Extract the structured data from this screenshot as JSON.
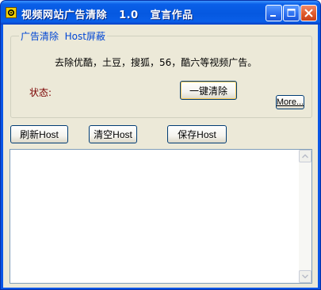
{
  "window": {
    "title": "视频网站广告清除   1.0   宣言作品",
    "controls": {
      "minimize_icon": "minimize-icon",
      "maximize_icon": "maximize-icon",
      "close_icon": "close-icon"
    }
  },
  "group": {
    "tab_labels": "广告清除  Host屏蔽",
    "description": "去除优酷，土豆，搜狐，56，酷六等视频广告。",
    "status_label": "状态:",
    "status_value": "",
    "clean_button": "一键清除",
    "more_button": "More..."
  },
  "hosts": {
    "refresh_button": "刷新Host",
    "clear_button": "清空Host",
    "save_button": "保存Host",
    "content": ""
  },
  "colors": {
    "titlebar": "#0a5fe8",
    "client_bg": "#ece9d8",
    "group_label": "#0046d5",
    "status_label": "#7a0000"
  }
}
